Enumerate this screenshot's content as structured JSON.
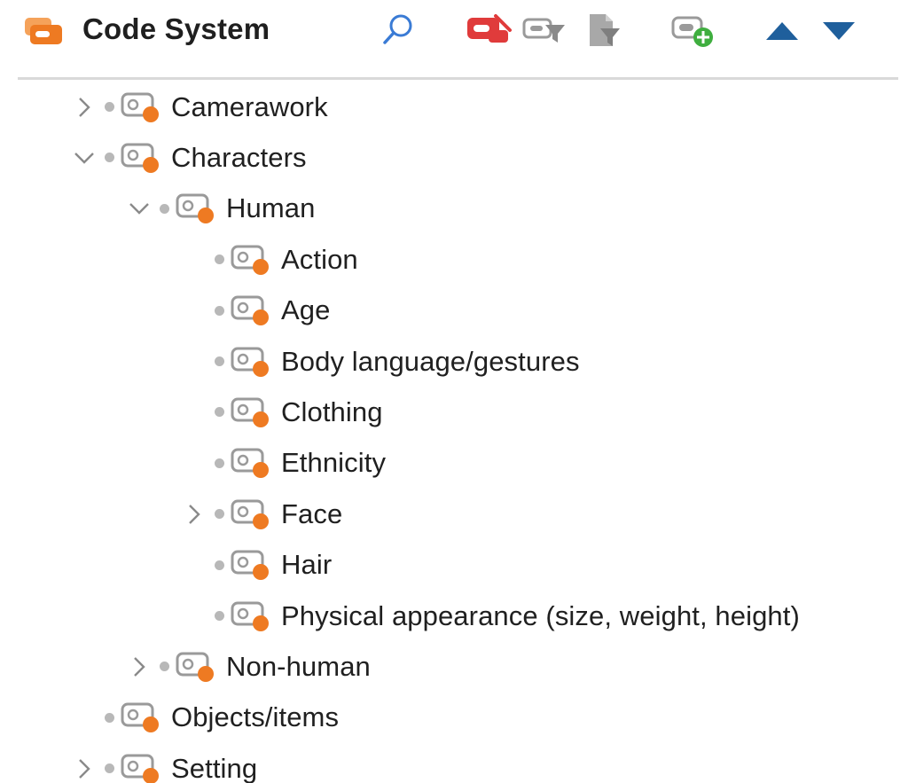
{
  "header": {
    "title": "Code System",
    "logo_icon": "code-system-icon",
    "toolbar": [
      {
        "name": "search-button",
        "icon": "search-icon"
      },
      {
        "name": "activate-codes-button",
        "icon": "activate-codes-icon"
      },
      {
        "name": "code-filter-button",
        "icon": "filter-code-icon"
      },
      {
        "name": "document-filter-button",
        "icon": "filter-document-icon"
      },
      {
        "name": "new-code-button",
        "icon": "add-code-icon"
      },
      {
        "name": "move-up-button",
        "icon": "triangle-up-icon"
      },
      {
        "name": "move-down-button",
        "icon": "triangle-down-icon"
      }
    ]
  },
  "colors": {
    "accent_orange": "#ee7a22",
    "icon_red": "#e03b3b",
    "icon_gray": "#8a8a8a",
    "arrow_blue": "#1f5f9c",
    "add_green": "#3fae3f"
  },
  "tree": {
    "nodes": [
      {
        "label": "Camerawork",
        "depth": 0,
        "chevron": "collapsed"
      },
      {
        "label": "Characters",
        "depth": 0,
        "chevron": "expanded"
      },
      {
        "label": "Human",
        "depth": 1,
        "chevron": "expanded"
      },
      {
        "label": "Action",
        "depth": 2,
        "chevron": "none"
      },
      {
        "label": "Age",
        "depth": 2,
        "chevron": "none"
      },
      {
        "label": "Body language/gestures",
        "depth": 2,
        "chevron": "none"
      },
      {
        "label": "Clothing",
        "depth": 2,
        "chevron": "none"
      },
      {
        "label": "Ethnicity",
        "depth": 2,
        "chevron": "none"
      },
      {
        "label": "Face",
        "depth": 2,
        "chevron": "collapsed"
      },
      {
        "label": "Hair",
        "depth": 2,
        "chevron": "none"
      },
      {
        "label": "Physical appearance (size, weight, height)",
        "depth": 2,
        "chevron": "none"
      },
      {
        "label": "Non-human",
        "depth": 1,
        "chevron": "collapsed"
      },
      {
        "label": "Objects/items",
        "depth": 0,
        "chevron": "none"
      },
      {
        "label": "Setting",
        "depth": 0,
        "chevron": "collapsed"
      }
    ]
  }
}
